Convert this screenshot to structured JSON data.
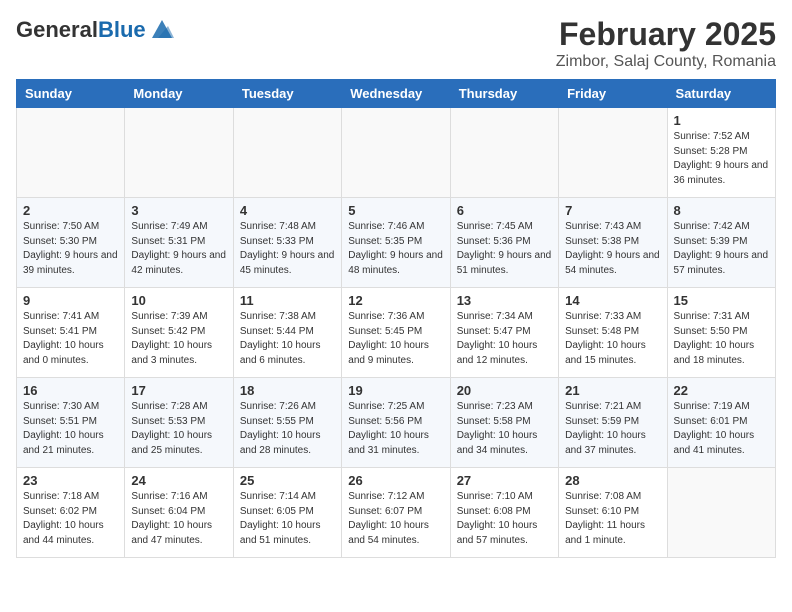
{
  "header": {
    "logo_general": "General",
    "logo_blue": "Blue",
    "title": "February 2025",
    "subtitle": "Zimbor, Salaj County, Romania"
  },
  "weekdays": [
    "Sunday",
    "Monday",
    "Tuesday",
    "Wednesday",
    "Thursday",
    "Friday",
    "Saturday"
  ],
  "weeks": [
    [
      {
        "day": "",
        "info": ""
      },
      {
        "day": "",
        "info": ""
      },
      {
        "day": "",
        "info": ""
      },
      {
        "day": "",
        "info": ""
      },
      {
        "day": "",
        "info": ""
      },
      {
        "day": "",
        "info": ""
      },
      {
        "day": "1",
        "info": "Sunrise: 7:52 AM\nSunset: 5:28 PM\nDaylight: 9 hours and 36 minutes."
      }
    ],
    [
      {
        "day": "2",
        "info": "Sunrise: 7:50 AM\nSunset: 5:30 PM\nDaylight: 9 hours and 39 minutes."
      },
      {
        "day": "3",
        "info": "Sunrise: 7:49 AM\nSunset: 5:31 PM\nDaylight: 9 hours and 42 minutes."
      },
      {
        "day": "4",
        "info": "Sunrise: 7:48 AM\nSunset: 5:33 PM\nDaylight: 9 hours and 45 minutes."
      },
      {
        "day": "5",
        "info": "Sunrise: 7:46 AM\nSunset: 5:35 PM\nDaylight: 9 hours and 48 minutes."
      },
      {
        "day": "6",
        "info": "Sunrise: 7:45 AM\nSunset: 5:36 PM\nDaylight: 9 hours and 51 minutes."
      },
      {
        "day": "7",
        "info": "Sunrise: 7:43 AM\nSunset: 5:38 PM\nDaylight: 9 hours and 54 minutes."
      },
      {
        "day": "8",
        "info": "Sunrise: 7:42 AM\nSunset: 5:39 PM\nDaylight: 9 hours and 57 minutes."
      }
    ],
    [
      {
        "day": "9",
        "info": "Sunrise: 7:41 AM\nSunset: 5:41 PM\nDaylight: 10 hours and 0 minutes."
      },
      {
        "day": "10",
        "info": "Sunrise: 7:39 AM\nSunset: 5:42 PM\nDaylight: 10 hours and 3 minutes."
      },
      {
        "day": "11",
        "info": "Sunrise: 7:38 AM\nSunset: 5:44 PM\nDaylight: 10 hours and 6 minutes."
      },
      {
        "day": "12",
        "info": "Sunrise: 7:36 AM\nSunset: 5:45 PM\nDaylight: 10 hours and 9 minutes."
      },
      {
        "day": "13",
        "info": "Sunrise: 7:34 AM\nSunset: 5:47 PM\nDaylight: 10 hours and 12 minutes."
      },
      {
        "day": "14",
        "info": "Sunrise: 7:33 AM\nSunset: 5:48 PM\nDaylight: 10 hours and 15 minutes."
      },
      {
        "day": "15",
        "info": "Sunrise: 7:31 AM\nSunset: 5:50 PM\nDaylight: 10 hours and 18 minutes."
      }
    ],
    [
      {
        "day": "16",
        "info": "Sunrise: 7:30 AM\nSunset: 5:51 PM\nDaylight: 10 hours and 21 minutes."
      },
      {
        "day": "17",
        "info": "Sunrise: 7:28 AM\nSunset: 5:53 PM\nDaylight: 10 hours and 25 minutes."
      },
      {
        "day": "18",
        "info": "Sunrise: 7:26 AM\nSunset: 5:55 PM\nDaylight: 10 hours and 28 minutes."
      },
      {
        "day": "19",
        "info": "Sunrise: 7:25 AM\nSunset: 5:56 PM\nDaylight: 10 hours and 31 minutes."
      },
      {
        "day": "20",
        "info": "Sunrise: 7:23 AM\nSunset: 5:58 PM\nDaylight: 10 hours and 34 minutes."
      },
      {
        "day": "21",
        "info": "Sunrise: 7:21 AM\nSunset: 5:59 PM\nDaylight: 10 hours and 37 minutes."
      },
      {
        "day": "22",
        "info": "Sunrise: 7:19 AM\nSunset: 6:01 PM\nDaylight: 10 hours and 41 minutes."
      }
    ],
    [
      {
        "day": "23",
        "info": "Sunrise: 7:18 AM\nSunset: 6:02 PM\nDaylight: 10 hours and 44 minutes."
      },
      {
        "day": "24",
        "info": "Sunrise: 7:16 AM\nSunset: 6:04 PM\nDaylight: 10 hours and 47 minutes."
      },
      {
        "day": "25",
        "info": "Sunrise: 7:14 AM\nSunset: 6:05 PM\nDaylight: 10 hours and 51 minutes."
      },
      {
        "day": "26",
        "info": "Sunrise: 7:12 AM\nSunset: 6:07 PM\nDaylight: 10 hours and 54 minutes."
      },
      {
        "day": "27",
        "info": "Sunrise: 7:10 AM\nSunset: 6:08 PM\nDaylight: 10 hours and 57 minutes."
      },
      {
        "day": "28",
        "info": "Sunrise: 7:08 AM\nSunset: 6:10 PM\nDaylight: 11 hours and 1 minute."
      },
      {
        "day": "",
        "info": ""
      }
    ]
  ]
}
